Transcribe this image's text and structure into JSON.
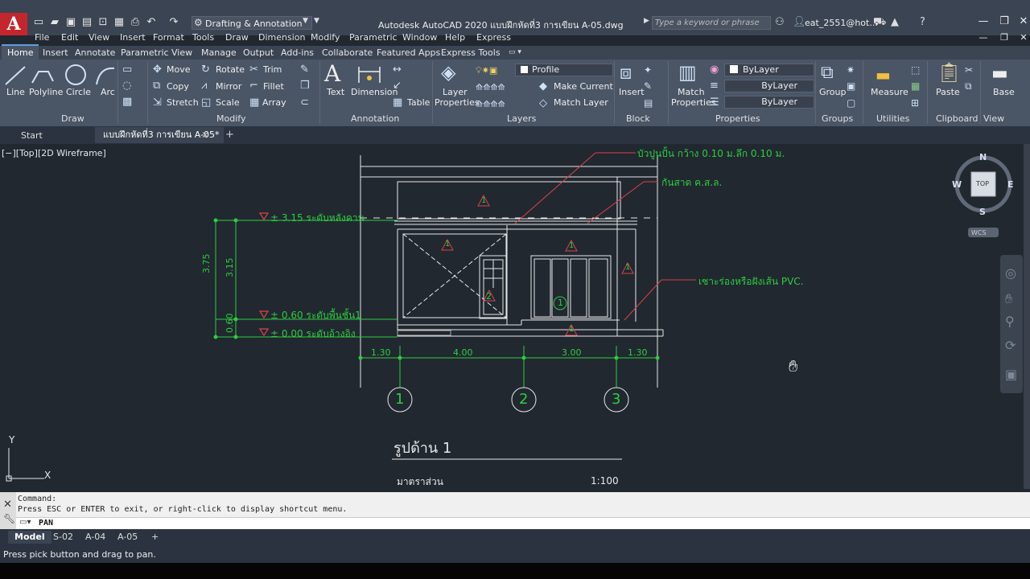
{
  "app": {
    "logo": "A",
    "title": "Autodesk AutoCAD 2020    แบบฝึกหัดที่3 การเขียน A-05.dwg",
    "workspace": "Drafting & Annotation",
    "search_placeholder": "Type a keyword or phrase",
    "user": "eat_2551@hot..."
  },
  "menu": [
    "File",
    "Edit",
    "View",
    "Insert",
    "Format",
    "Tools",
    "Draw",
    "Dimension",
    "Modify",
    "Parametric",
    "Window",
    "Help",
    "Express"
  ],
  "ribbon_tabs": [
    "Home",
    "Insert",
    "Annotate",
    "Parametric",
    "View",
    "Manage",
    "Output",
    "Add-ins",
    "Collaborate",
    "Featured Apps",
    "Express Tools"
  ],
  "ribbon": {
    "draw": {
      "line": "Line",
      "polyline": "Polyline",
      "circle": "Circle",
      "arc": "Arc",
      "title": "Draw"
    },
    "modify": {
      "move": "Move",
      "rotate": "Rotate",
      "trim": "Trim",
      "copy": "Copy",
      "mirror": "Mirror",
      "fillet": "Fillet",
      "stretch": "Stretch",
      "scale": "Scale",
      "array": "Array",
      "title": "Modify"
    },
    "annotation": {
      "text": "Text",
      "dimension": "Dimension",
      "table": "Table",
      "title": "Annotation"
    },
    "layers": {
      "layer_properties_1": "Layer",
      "layer_properties_2": "Properties",
      "current_layer": "Profile",
      "make_current": "Make Current",
      "match_layer": "Match Layer",
      "title": "Layers"
    },
    "block": {
      "insert": "Insert",
      "title": "Block"
    },
    "properties": {
      "match_1": "Match",
      "match_2": "Properties",
      "color": "ByLayer",
      "linetype": "ByLayer",
      "lineweight": "ByLayer",
      "title": "Properties"
    },
    "groups": {
      "group": "Group",
      "title": "Groups"
    },
    "utilities": {
      "measure": "Measure",
      "title": "Utilities"
    },
    "clipboard": {
      "paste": "Paste",
      "title": "Clipboard"
    },
    "view": {
      "base": "Base",
      "title": "View"
    }
  },
  "file_tabs": {
    "start": "Start",
    "doc": "แบบฝึกหัดที่3 การเขียน A-05*"
  },
  "viewport_label": "[−][Top][2D Wireframe]",
  "viewcube": {
    "n": "N",
    "s": "S",
    "e": "E",
    "w": "W",
    "top": "TOP",
    "wcs": "WCS"
  },
  "drawing": {
    "notes": {
      "top": "บัวปูนปั้น กว้าง 0.10 ม.ลึก 0.10 ม.",
      "canopy": "กันสาด ค.ส.ล.",
      "pvc": "เซาะร่องหรือฝังเส้น PVC."
    },
    "levels": {
      "beam": "± 3.15 ระดับหลังคาน",
      "floor": "± 0.60 ระดับพื้นชั้น1",
      "ref": "± 0.00 ระดับอ้างอิง"
    },
    "vdims": {
      "total": "3.75",
      "upper": "3.15",
      "lower": "0.60"
    },
    "hdims": [
      "1.30",
      "4.00",
      "3.00",
      "1.30"
    ],
    "grids": [
      "1",
      "2",
      "3"
    ],
    "tags": [
      "1",
      "1",
      "1",
      "1",
      "1",
      "2",
      "1",
      "1"
    ],
    "title": "รูปด้าน 1",
    "scale_label": "มาตราส่วน",
    "scale_value": "1:100",
    "ucs": {
      "x": "X",
      "y": "Y"
    }
  },
  "command": {
    "line1": "Command:",
    "line2": "Press ESC or ENTER to exit, or right-click to display shortcut menu.",
    "input": "PAN"
  },
  "layout_tabs": [
    "Model",
    "S-02",
    "A-04",
    "A-05"
  ],
  "status_text": "Press pick button and drag to pan."
}
